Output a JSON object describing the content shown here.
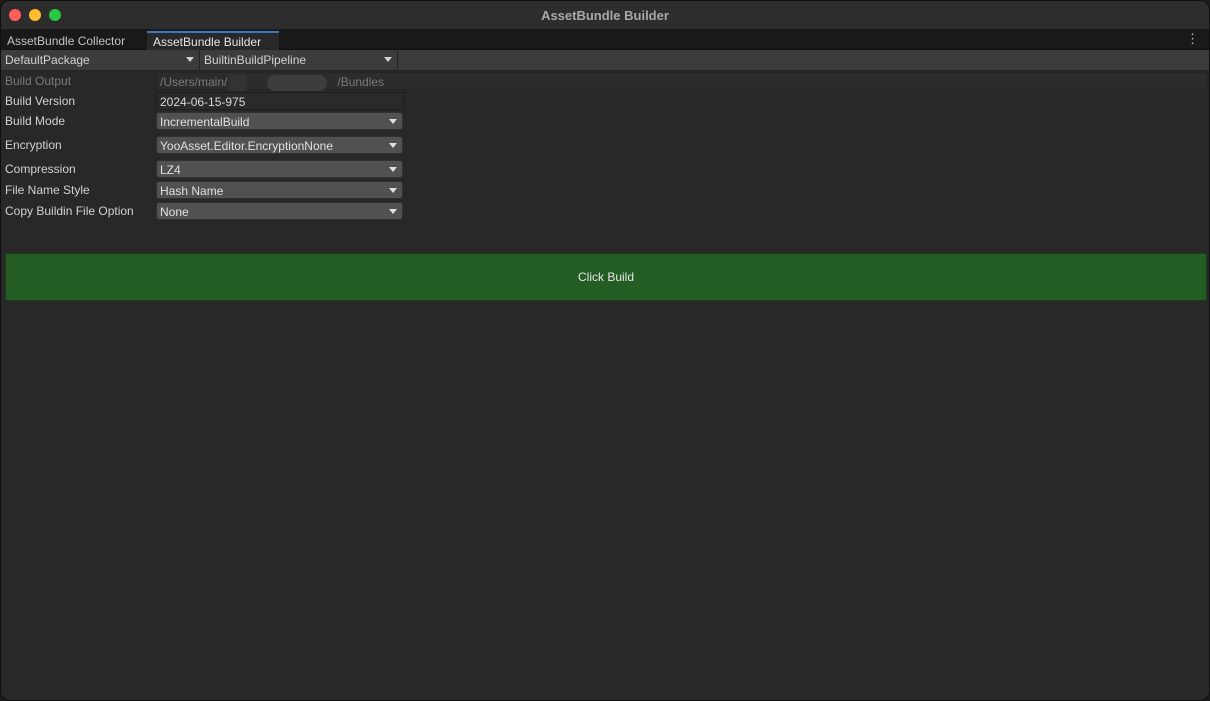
{
  "window": {
    "title": "AssetBundle Builder"
  },
  "tabs": [
    {
      "label": "AssetBundle Collector"
    },
    {
      "label": "AssetBundle Builder"
    }
  ],
  "toolbar": {
    "package": "DefaultPackage",
    "pipeline": "BuiltinBuildPipeline"
  },
  "form": {
    "build_output": {
      "label": "Build Output",
      "value_start": "/Users/main/",
      "value_end": "/Bundles"
    },
    "build_version": {
      "label": "Build Version",
      "value": "2024-06-15-975"
    },
    "build_mode": {
      "label": "Build Mode",
      "value": "IncrementalBuild"
    },
    "encryption": {
      "label": "Encryption",
      "value": "YooAsset.Editor.EncryptionNone"
    },
    "compression": {
      "label": "Compression",
      "value": "LZ4"
    },
    "file_name_style": {
      "label": "File Name Style",
      "value": "Hash Name"
    },
    "copy_buildin": {
      "label": "Copy Buildin File Option",
      "value": "None"
    }
  },
  "build_button": {
    "label": "Click Build"
  },
  "colors": {
    "background": "#282828",
    "build_button": "#245d24",
    "active_tab_accent": "#3a79bb"
  }
}
